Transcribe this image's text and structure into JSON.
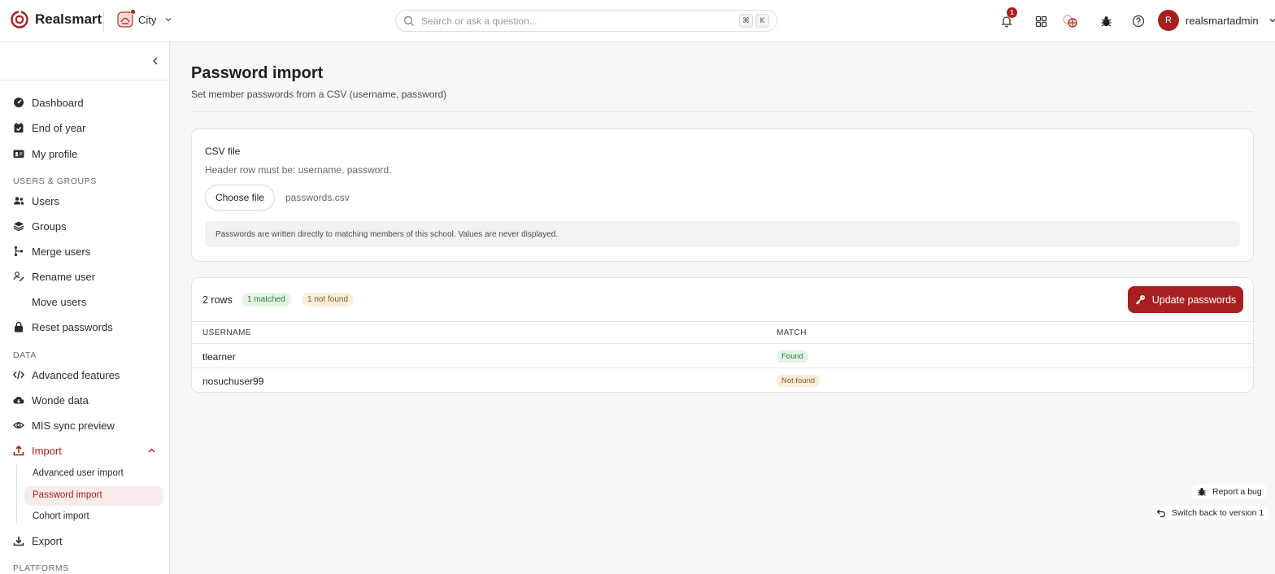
{
  "brand": {
    "name": "Realsmart"
  },
  "school": {
    "name": "City"
  },
  "search": {
    "placeholder": "Search or ask a question...",
    "shortcut_cmd": "⌘",
    "shortcut_key": "K"
  },
  "notifications": {
    "count": "1"
  },
  "user": {
    "initial": "R",
    "name": "realsmartadmin"
  },
  "sidebar": {
    "items": [
      {
        "label": "Dashboard",
        "icon": "dashboard-icon"
      },
      {
        "label": "End of year",
        "icon": "calendar-check-icon"
      },
      {
        "label": "My profile",
        "icon": "id-card-icon"
      }
    ],
    "section_users": "USERS & GROUPS",
    "users_items": [
      {
        "label": "Users",
        "icon": "users-icon"
      },
      {
        "label": "Groups",
        "icon": "layers-icon"
      },
      {
        "label": "Merge users",
        "icon": "merge-icon"
      },
      {
        "label": "Rename user",
        "icon": "user-edit-icon"
      },
      {
        "label": "Move users"
      },
      {
        "label": "Reset passwords",
        "icon": "lock-icon"
      }
    ],
    "section_data": "DATA",
    "data_items": [
      {
        "label": "Advanced features",
        "icon": "code-icon"
      },
      {
        "label": "Wonde data",
        "icon": "cloud-download-icon"
      },
      {
        "label": "MIS sync preview",
        "icon": "eye-icon"
      },
      {
        "label": "Import",
        "icon": "upload-icon",
        "active": true
      }
    ],
    "import_sub": [
      {
        "label": "Advanced user import"
      },
      {
        "label": "Password import",
        "active": true
      },
      {
        "label": "Cohort import"
      }
    ],
    "export_label": "Export",
    "section_platforms": "PLATFORMS"
  },
  "page": {
    "title": "Password import",
    "subtitle": "Set member passwords from a CSV (username, password)"
  },
  "upload": {
    "label": "CSV file",
    "help": "Header row must be: username, password.",
    "choose_button": "Choose file",
    "file_name": "passwords.csv",
    "note": "Passwords are written directly to matching members of this school. Values are never displayed."
  },
  "results": {
    "rows_label": "2 rows",
    "matched_pill": "1 matched",
    "not_found_pill": "1 not found",
    "update_button": "Update passwords",
    "columns": [
      "USERNAME",
      "MATCH"
    ],
    "rows": [
      {
        "username": "tlearner",
        "match": "Found"
      },
      {
        "username": "nosuchuser99",
        "match": "Not found"
      }
    ]
  },
  "footer": {
    "report_bug": "Report a bug",
    "switch_version": "Switch back to version 1"
  },
  "colors": {
    "accent": "#a81f1f",
    "success": "#2e7d32",
    "warning": "#8a5a12"
  }
}
